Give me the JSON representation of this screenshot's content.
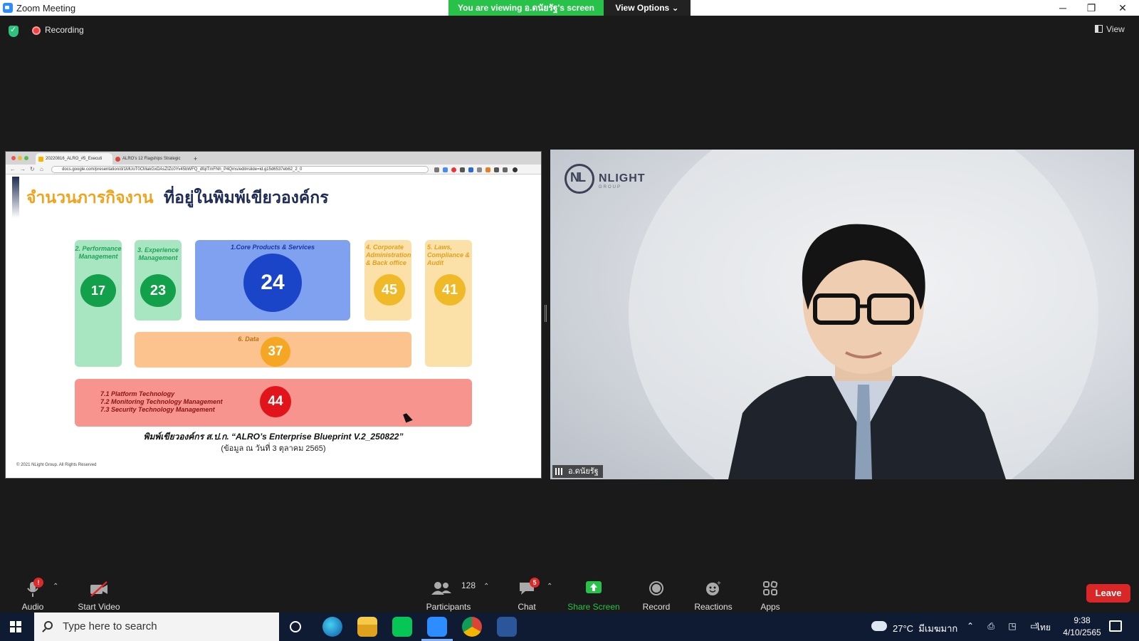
{
  "window": {
    "title": "Zoom Meeting",
    "viewing_banner": "You are viewing อ.ดนัยรัฐ's screen",
    "view_options": "View Options ⌄",
    "minimize": "─",
    "restore": "❐",
    "close": "✕"
  },
  "meeting_bar": {
    "recording": "Recording",
    "view": "View"
  },
  "browser": {
    "tabs": [
      {
        "label": "20220816_ALRO_#5_Executi",
        "active": true
      },
      {
        "label": "ALRO's 12 Flagships Strategic",
        "active": false
      }
    ],
    "new_tab": "+",
    "tab_close": "×",
    "url": "docs.google.com/presentation/d/1MUoT0CMakGxDAsZIZc0Yv45bWFQ_dfqITmFNh_P4Qms/edit#slide=id.g15d6537eb62_2_0"
  },
  "slide": {
    "title_part1": "จำนวนภารกิจงาน",
    "title_part2": "ที่อยู่ในพิมพ์เขียวองค์กร",
    "boxes": {
      "performance": {
        "label": "2. Performance Management",
        "value": "17"
      },
      "experience": {
        "label": "3. Experience Management",
        "value": "23"
      },
      "core": {
        "label": "1.Core Products & Services",
        "value": "24"
      },
      "corporate": {
        "label": "4. Corporate Administration & Back office",
        "value": "45"
      },
      "laws": {
        "label": "5. Laws, Compliance & Audit",
        "value": "41"
      },
      "data": {
        "label": "6. Data",
        "value": "37"
      },
      "platform": {
        "lines": [
          "7.1 Platform Technology",
          "7.2 Monitoring Technology Management",
          "7.3 Security Technology Management"
        ],
        "value": "44"
      }
    },
    "blueprint_title": "พิมพ์เขียวองค์กร ส.ป.ก. “ALRO’s Enterprise Blueprint V.2_250822”",
    "blueprint_sub": "(ข้อมูล ณ วันที่ 3 ตุลาคม 2565)",
    "copyright": "© 2021 NLight Group. All Rights Reserved"
  },
  "video": {
    "logo_text": "NLIGHT",
    "logo_sub": "GROUP",
    "participant_name": "อ.ดนัยรัฐ"
  },
  "toolbar": {
    "audio": "Audio",
    "audio_badge": "!",
    "start_video": "Start Video",
    "participants": "Participants",
    "participants_count": "128",
    "chat": "Chat",
    "chat_badge": "5",
    "share_screen": "Share Screen",
    "record": "Record",
    "reactions": "Reactions",
    "apps": "Apps",
    "leave": "Leave",
    "caret": "⌃"
  },
  "taskbar": {
    "search_placeholder": "Type here to search",
    "temperature": "27°C",
    "weather_text": "มีเมฆมาก",
    "tray_glyphs": "⌃ ⎙ ◳ ▭",
    "language": "ไทย",
    "time": "9:38",
    "date": "4/10/2565"
  },
  "colors": {
    "share_green": "#28c24a",
    "leave_red": "#d92626",
    "core_blue": "#1a45c9",
    "data_orange": "#f5a623",
    "platform_red": "#e0141a",
    "green_circle": "#12a04a",
    "yellow_circle": "#f0b928"
  }
}
